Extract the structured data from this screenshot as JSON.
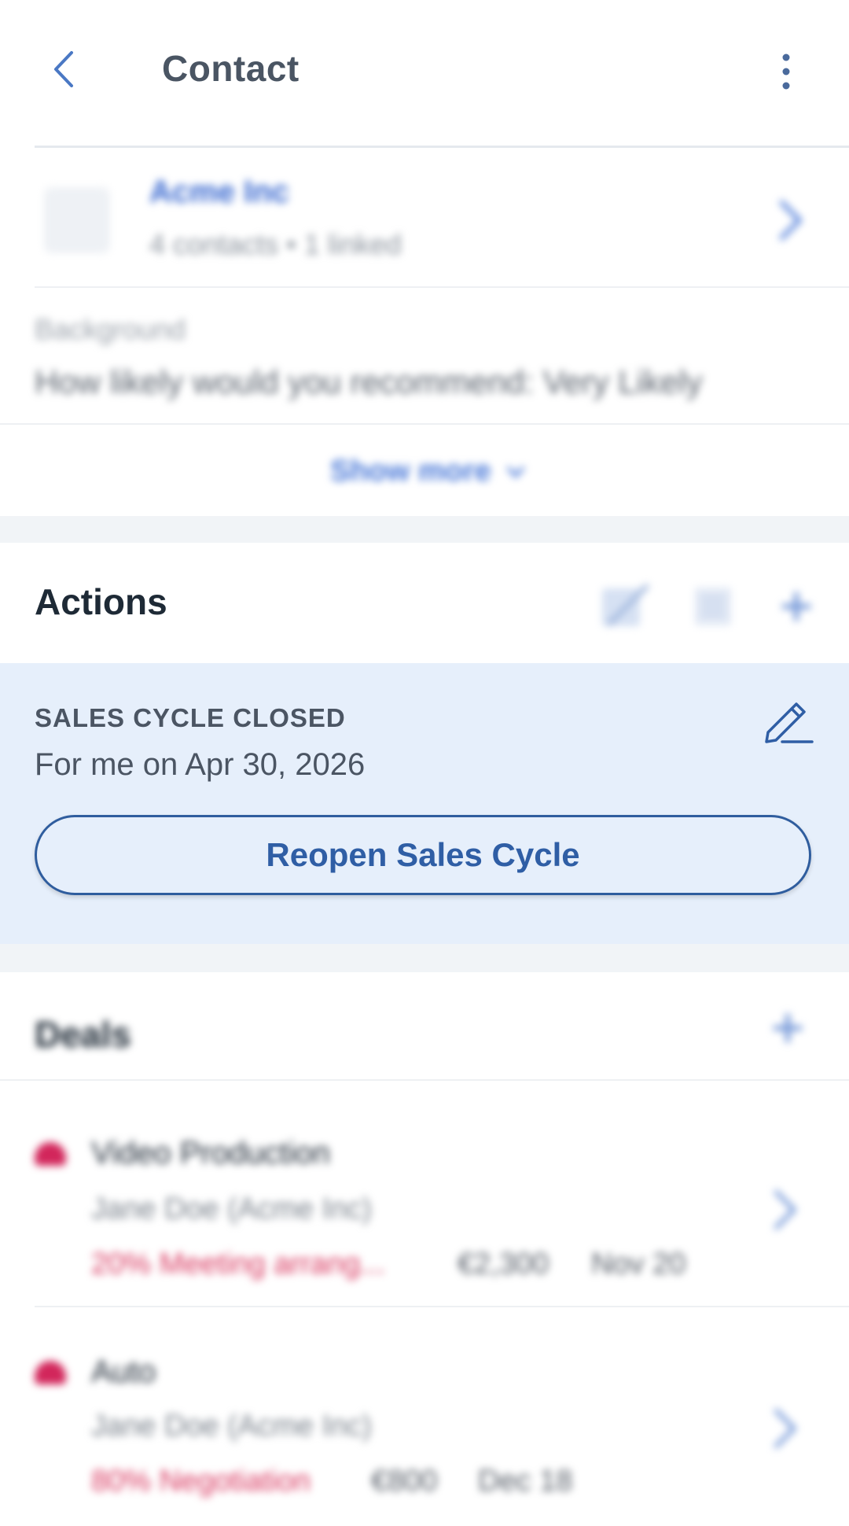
{
  "header": {
    "title": "Contact"
  },
  "company": {
    "name": "Acme Inc",
    "subtitle": "4 contacts • 1 linked"
  },
  "background": {
    "label": "Background",
    "text": "How likely would you recommend: Very Likely"
  },
  "show_more": {
    "label": "Show more"
  },
  "actions": {
    "title": "Actions",
    "status_label": "SALES CYCLE CLOSED",
    "status_sub": "For me on Apr 30, 2026",
    "reopen_label": "Reopen Sales Cycle"
  },
  "deals": {
    "title": "Deals",
    "items": [
      {
        "name": "Video Production",
        "company": "Jane Doe (Acme Inc)",
        "stage": "20% Meeting arrang...",
        "amount": "€2,300",
        "date": "Nov 20"
      },
      {
        "name": "Auto",
        "company": "Jane Doe (Acme Inc)",
        "stage": "80% Negotiation",
        "amount": "€800",
        "date": "Dec 18"
      }
    ]
  },
  "colors": {
    "accent": "#2f5ea5",
    "panel_bg": "#e6effb",
    "deal_stage": "#d8375f",
    "link": "#3b6ad0"
  }
}
